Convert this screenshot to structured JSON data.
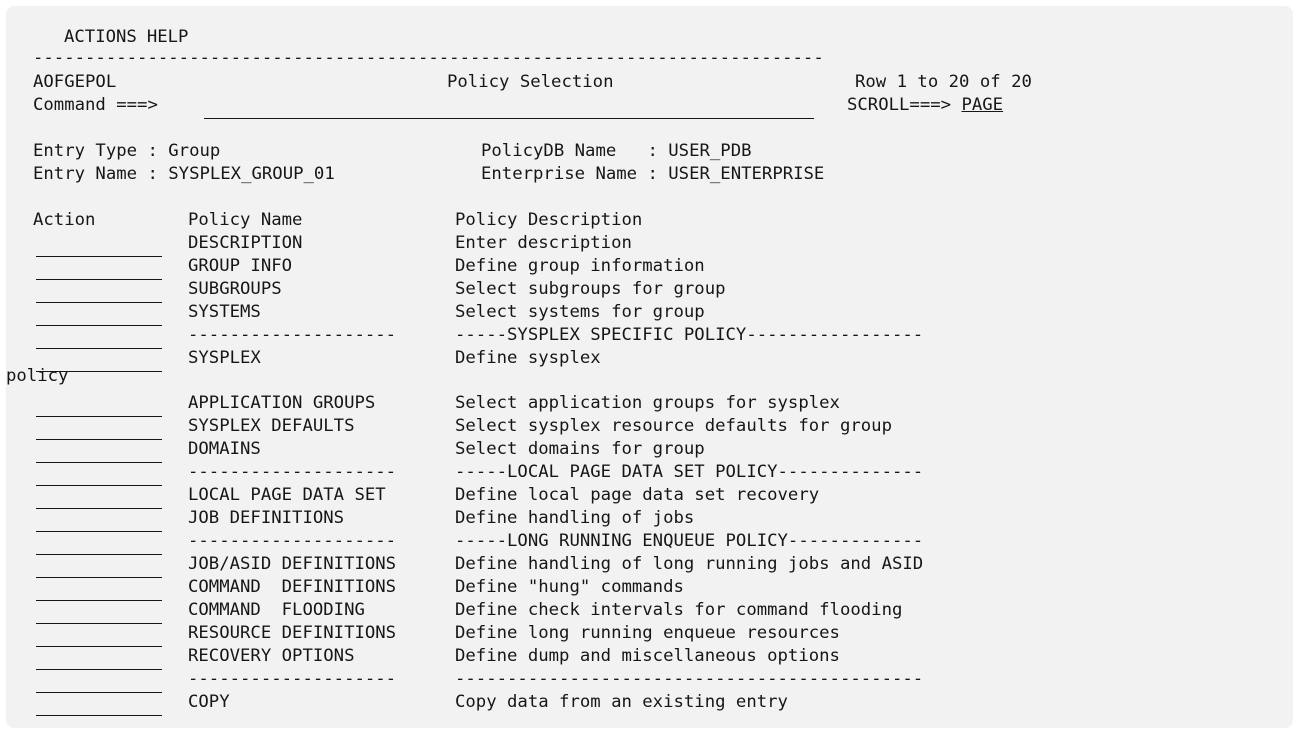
{
  "menu": {
    "actions": "ACTIONS",
    "help": "HELP"
  },
  "header": {
    "separator": "----------------------------------------------------------------------------",
    "panel_id": "AOFGEPOL",
    "title": "Policy Selection",
    "row_info": "Row 1 to 20 of 20",
    "command_label": "Command ===>",
    "command_value": "",
    "scroll_label": "SCROLL===>",
    "scroll_value": "PAGE"
  },
  "entry": {
    "type_label": "Entry Type : Group",
    "name_label": "Entry Name : SYSPLEX_GROUP_01",
    "policydb_label": "PolicyDB Name   : USER_PDB",
    "enterprise_label": "Enterprise Name : USER_ENTERPRISE"
  },
  "columns": {
    "action": "Action",
    "policy_name": "Policy Name",
    "policy_description": "Policy Description"
  },
  "rows": [
    {
      "name": "DESCRIPTION",
      "desc": "Enter description"
    },
    {
      "name": "GROUP INFO",
      "desc": "Define group information"
    },
    {
      "name": "SUBGROUPS",
      "desc": "Select subgroups for group"
    },
    {
      "name": "SYSTEMS",
      "desc": "Select systems for group"
    },
    {
      "name": "--------------------",
      "desc": "-----SYSPLEX SPECIFIC POLICY-----------------"
    },
    {
      "name": "SYSPLEX",
      "desc": "Define sysplex"
    },
    {
      "name": "APPLICATION GROUPS",
      "desc": "Select application groups for sysplex"
    },
    {
      "name": "SYSPLEX DEFAULTS",
      "desc": "Select sysplex resource defaults for group"
    },
    {
      "name": "DOMAINS",
      "desc": "Select domains for group"
    },
    {
      "name": "--------------------",
      "desc": "-----LOCAL PAGE DATA SET POLICY--------------"
    },
    {
      "name": "LOCAL PAGE DATA SET",
      "desc": "Define local page data set recovery"
    },
    {
      "name": "JOB DEFINITIONS",
      "desc": "Define handling of jobs"
    },
    {
      "name": "--------------------",
      "desc": "-----LONG RUNNING ENQUEUE POLICY-------------"
    },
    {
      "name": "JOB/ASID DEFINITIONS",
      "desc": "Define handling of long running jobs and ASID"
    },
    {
      "name": "COMMAND  DEFINITIONS",
      "desc": "Define \"hung\" commands"
    },
    {
      "name": "COMMAND  FLOODING",
      "desc": "Define check intervals for command flooding"
    },
    {
      "name": "RESOURCE DEFINITIONS",
      "desc": "Define long running enqueue resources"
    },
    {
      "name": "RECOVERY OPTIONS",
      "desc": "Define dump and miscellaneous options"
    },
    {
      "name": "--------------------",
      "desc": "---------------------------------------------"
    },
    {
      "name": "COPY",
      "desc": "Copy data from an existing entry"
    }
  ],
  "wrap_text": "policy"
}
